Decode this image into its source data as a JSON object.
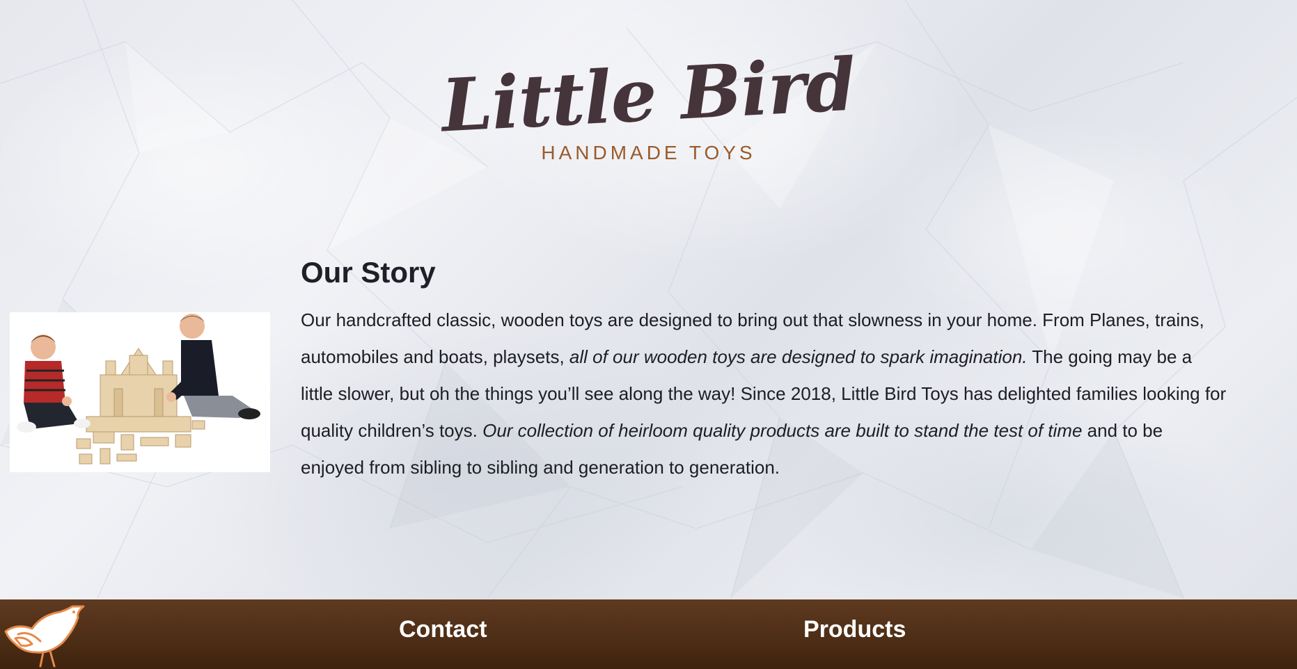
{
  "brand": {
    "title": "Little Bird",
    "subtitle": "HANDMADE TOYS"
  },
  "story": {
    "heading": "Our Story",
    "p1": "Our handcrafted classic, wooden toys are designed to bring out that slowness in your home. From Planes, trains, automobiles and boats, playsets, ",
    "p1_em": "all of our wooden toys are designed to spark imagination.",
    "p2": " The going may be a little slower, but oh the things you’ll see along the way! Since 2018, Little Bird Toys has delighted families looking for quality children’s toys. ",
    "p2_em": "Our collection of heirloom quality products are built to stand the test of time",
    "p3": " and to be enjoyed from sibling to sibling and generation to generation.",
    "image_icon": "children-playing-with-wooden-blocks-photo"
  },
  "footer": {
    "logo_icon": "bird-logo-icon",
    "contact_label": "Contact",
    "products_label": "Products"
  },
  "colors": {
    "brand_title": "#45343a",
    "brand_subtitle": "#9a5a2a",
    "footer_bg": "#4e2e16",
    "footer_text": "#ffffff",
    "body_text": "#1d1d24"
  }
}
